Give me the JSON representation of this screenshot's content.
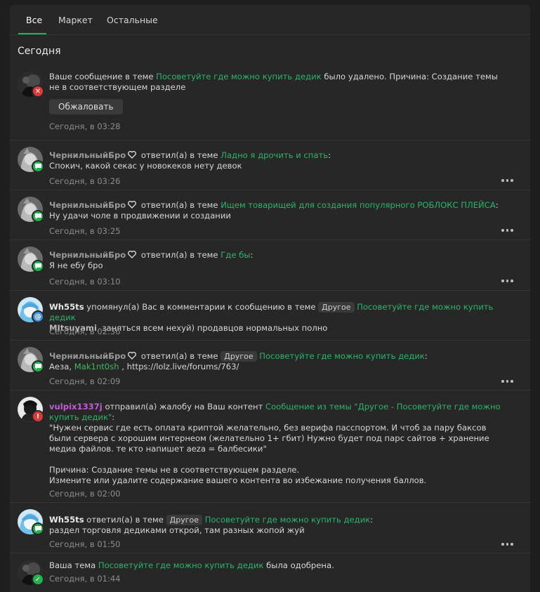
{
  "tabs": [
    "Все",
    "Маркет",
    "Остальные"
  ],
  "section_title": "Сегодня",
  "appeal_label": "Обжаловать",
  "colors": {
    "accent": "#20b36a",
    "link": "#29b66a",
    "badge_red": "#dc3a3a",
    "badge_green": "#22b14c",
    "badge_blue": "#3a8bd8"
  },
  "items": [
    {
      "text1": "Ваше сообщение в теме ",
      "link": "Посоветуйте где можно купить дедик",
      "text2": " было удалено. Причина: Создание темы не в соответствующем разделе",
      "time": "Сегодня, в 03:28",
      "badge_icon": "x-icon"
    },
    {
      "user": "ЧернильныйБро",
      "action": " ответил(а) в теме ",
      "link": "Ладно я дрочить и спать",
      "colon": ":",
      "body": "Спокич, какой секас у новокеков нету девок",
      "time": "Сегодня, в 03:26",
      "badge_icon": "chat-icon"
    },
    {
      "user": "ЧернильныйБро",
      "action": " ответил(а) в теме ",
      "link": "Ищем товарищей для создания популярного РОБЛОКС ПЛЕЙСА",
      "colon": ":",
      "body": "Ну удачи чоле в продвижении и создании",
      "time": "Сегодня, в 03:25",
      "badge_icon": "chat-icon"
    },
    {
      "user": "ЧернильныйБро",
      "action": " ответил(а) в теме ",
      "link": "Где бы",
      "colon": ":",
      "body": "Я не ебу бро",
      "time": "Сегодня, в 03:10",
      "badge_icon": "chat-icon"
    },
    {
      "user": "Wh55ts",
      "action": " упомянул(а) Вас в комментарии к сообщению в теме ",
      "tag": "Другое",
      "link": "Посоветуйте где можно купить дедик",
      "mention": "MItsuyami",
      "body": ", заняться всем нехуй) продавцов нормальных полно",
      "time": "Сегодня, в 02:36",
      "badge_icon": "at-icon"
    },
    {
      "user": "ЧернильныйБро",
      "action": " ответил(а) в теме ",
      "tag": "Другое",
      "link": "Посоветуйте где можно купить дедик",
      "colon": ":",
      "body_pre": "Аеза, ",
      "mention": "Mak1nt0sh",
      "body_post": " , https://lolz.live/forums/763/",
      "time": "Сегодня, в 02:09",
      "badge_icon": "chat-icon"
    },
    {
      "user": "vulpix1337j",
      "action": " отправил(а) жалобу на Ваш контент ",
      "link": "Сообщение из темы \"Другое - Посоветуйте где можно купить дедик\"",
      "colon": ":",
      "quote": "\"Нужен сервис где есть оплата криптой желательно, без верифа пасспортом. И чтоб за пару баксов были сервера с хорошим интернеом (желательно 1+ гбит) Нужно будет под парс сайтов + хранение медиа файлов. те кто напишет aeza = балбесики\"",
      "reason": "Причина: Создание темы не в соответствующем разделе.",
      "advice": "Измените или удалите содержание вашего контента во избежание получения баллов.",
      "time": "Сегодня, в 02:00",
      "badge_icon": "exclamation-icon"
    },
    {
      "user": "Wh55ts",
      "action": " ответил(а) в теме ",
      "tag": "Другое",
      "link": "Посоветуйте где можно купить дедик",
      "colon": ":",
      "body": "раздел торговля дедиками открой, там разных жопой жуй",
      "time": "Сегодня, в 01:50",
      "badge_icon": "chat-icon"
    },
    {
      "text1": "Ваша тема ",
      "link": "Посоветуйте где можно купить дедик",
      "text2": " была одобрена.",
      "time": "Сегодня, в 01:44",
      "badge_icon": "check-icon"
    }
  ]
}
